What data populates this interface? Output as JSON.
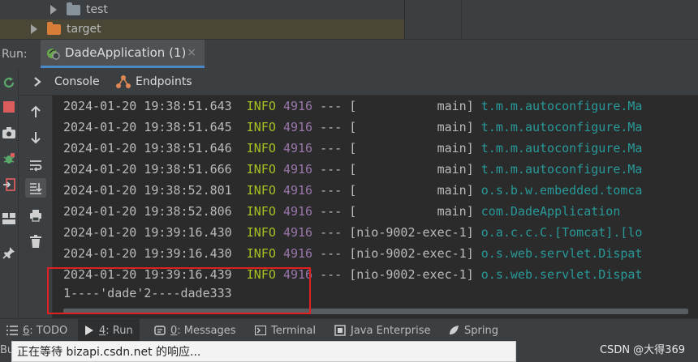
{
  "tree": {
    "items": [
      {
        "label": "test",
        "icon": "folder-icon",
        "color": "#87939a"
      },
      {
        "label": "target",
        "icon": "folder-icon",
        "color": "#d87d38"
      }
    ]
  },
  "run": {
    "label": "Run:",
    "tab_label": "DadeApplication (1)",
    "close": "×"
  },
  "console_tabs": [
    {
      "label": "Console",
      "icon": "console-icon"
    },
    {
      "label": "Endpoints",
      "icon": "endpoints-icon"
    }
  ],
  "log_lines": [
    {
      "ts": "2024-01-20 19:38:51.643",
      "level": "INFO",
      "pid": "4916",
      "sep": "---",
      "thread": "[           main]",
      "logger": "t.m.m.autoconfigure.Ma"
    },
    {
      "ts": "2024-01-20 19:38:51.645",
      "level": "INFO",
      "pid": "4916",
      "sep": "---",
      "thread": "[           main]",
      "logger": "t.m.m.autoconfigure.Ma"
    },
    {
      "ts": "2024-01-20 19:38:51.646",
      "level": "INFO",
      "pid": "4916",
      "sep": "---",
      "thread": "[           main]",
      "logger": "t.m.m.autoconfigure.Ma"
    },
    {
      "ts": "2024-01-20 19:38:51.666",
      "level": "INFO",
      "pid": "4916",
      "sep": "---",
      "thread": "[           main]",
      "logger": "t.m.m.autoconfigure.Ma"
    },
    {
      "ts": "2024-01-20 19:38:52.801",
      "level": "INFO",
      "pid": "4916",
      "sep": "---",
      "thread": "[           main]",
      "logger": "o.s.b.w.embedded.tomca"
    },
    {
      "ts": "2024-01-20 19:38:52.806",
      "level": "INFO",
      "pid": "4916",
      "sep": "---",
      "thread": "[           main]",
      "logger": "com.DadeApplication"
    },
    {
      "ts": "2024-01-20 19:39:16.430",
      "level": "INFO",
      "pid": "4916",
      "sep": "---",
      "thread": "[nio-9002-exec-1]",
      "logger": "o.a.c.c.C.[Tomcat].[lo"
    },
    {
      "ts": "2024-01-20 19:39:16.430",
      "level": "INFO",
      "pid": "4916",
      "sep": "---",
      "thread": "[nio-9002-exec-1]",
      "logger": "o.s.web.servlet.Dispat"
    },
    {
      "ts": "2024-01-20 19:39:16.439",
      "level": "INFO",
      "pid": "4916",
      "sep": "---",
      "thread": "[nio-9002-exec-1]",
      "logger": "o.s.web.servlet.Dispat"
    }
  ],
  "output_line": "1----'dade'2----dade333",
  "bottom_tools": [
    {
      "num": "6",
      "rest": ": TODO",
      "icon": "todo-icon",
      "active": false
    },
    {
      "num": "4",
      "rest": ": Run",
      "icon": "run-icon",
      "active": true
    },
    {
      "num": "0",
      "rest": ": Messages",
      "icon": "messages-icon",
      "active": false
    },
    {
      "num": "",
      "rest": "Terminal",
      "icon": "terminal-icon",
      "active": false
    },
    {
      "num": "",
      "rest": "Java Enterprise",
      "icon": "java-enterprise-icon",
      "active": false
    },
    {
      "num": "",
      "rest": "Spring",
      "icon": "spring-icon",
      "active": false
    }
  ],
  "status": {
    "left_fragment": "Bu",
    "tooltip": "正在等待 bizapi.csdn.net 的响应...",
    "watermark": "CSDN @大得369"
  },
  "colors": {
    "info": "#a8c023",
    "pid": "#9876aa",
    "logger": "#299999",
    "highlight": "#e02020",
    "tab_accent": "#4a88c7"
  }
}
